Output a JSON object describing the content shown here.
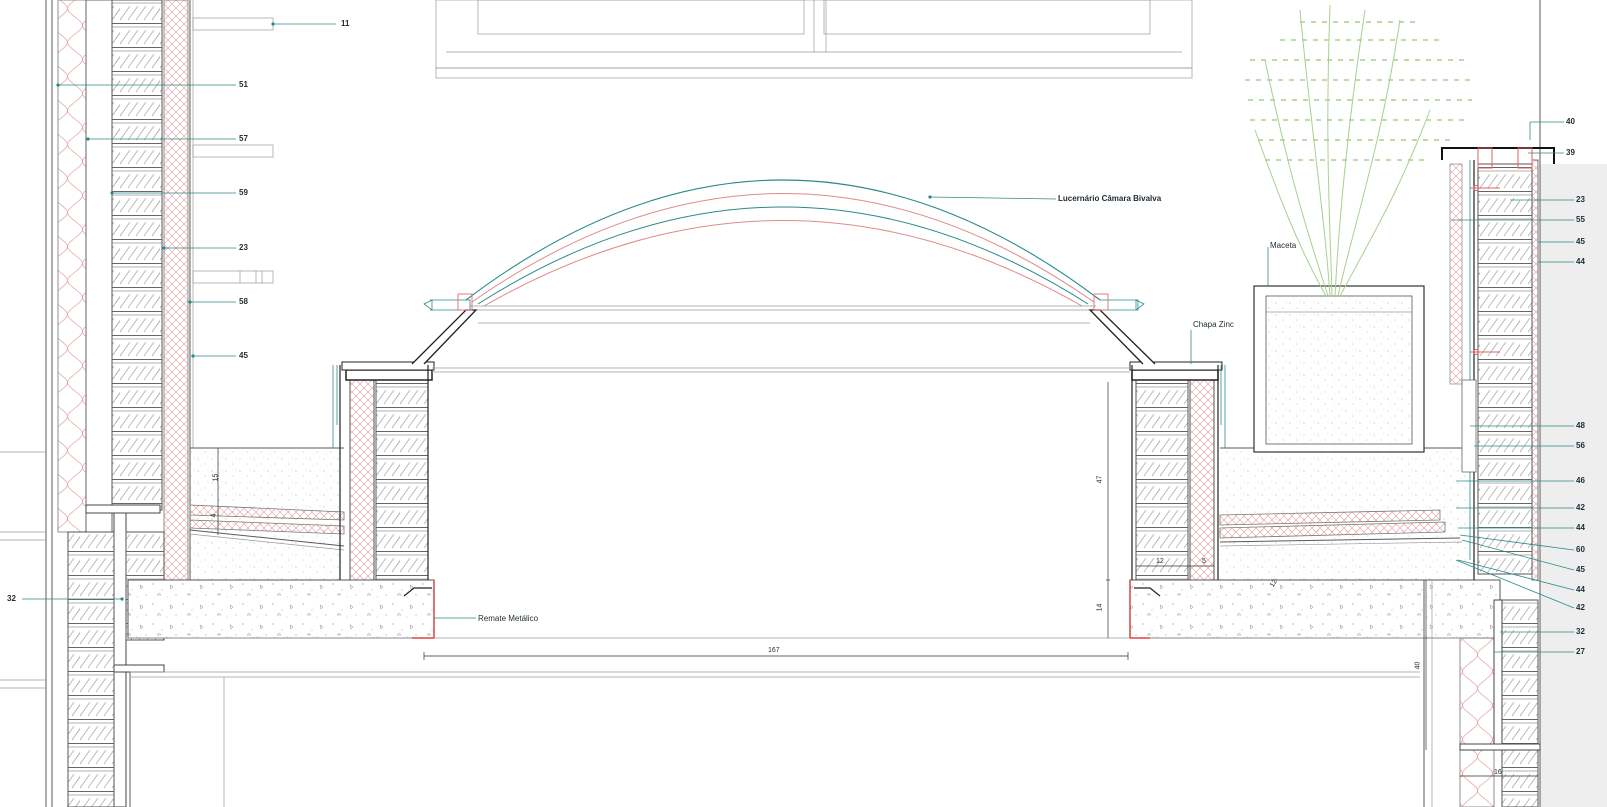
{
  "colors": {
    "line": "#5a5a5a",
    "leader": "#2a8a8a",
    "insulation": "#e08a8a",
    "plant": "#9bc87a",
    "background": "#ffffff",
    "wall_shade": "#eeeeee"
  },
  "title_labels": {
    "skylight": "Lucernário Câmara Bivalva",
    "planter": "Maceta",
    "zinc": "Chapa Zinc",
    "metal": "Remate Metálico"
  },
  "left_tags": [
    "11",
    "51",
    "57",
    "59",
    "23",
    "58",
    "45"
  ],
  "left_bottom_tag": "32",
  "right_tags": [
    "40",
    "39",
    "23",
    "55",
    "45",
    "44",
    "48",
    "56",
    "46",
    "42",
    "44",
    "60",
    "45",
    "44",
    "42",
    "32",
    "27"
  ],
  "dimensions": {
    "d15": "15",
    "d12": "12",
    "d12b": "12",
    "d5": "5",
    "d47": "47",
    "d14": "14",
    "d167": "167",
    "d40": "40",
    "d16": "16",
    "d4": "4"
  }
}
